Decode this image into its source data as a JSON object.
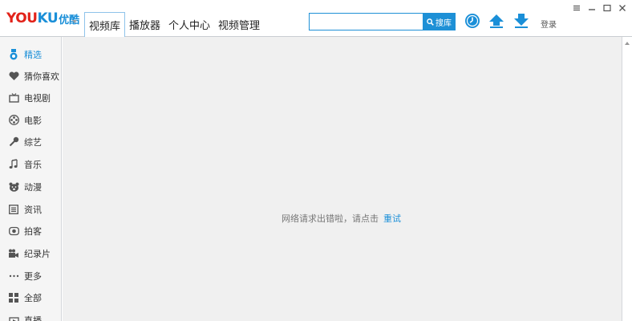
{
  "logo": {
    "en_you": "YOU",
    "en_ku": "KU",
    "cn": "优酷"
  },
  "tabs": [
    {
      "label": "视频库",
      "active": true
    },
    {
      "label": "播放器",
      "active": false
    },
    {
      "label": "个人中心",
      "active": false
    },
    {
      "label": "视频管理",
      "active": false
    }
  ],
  "search": {
    "value": "",
    "placeholder": "",
    "button_label": "搜库"
  },
  "toolbar": {
    "login_label": "登录"
  },
  "sidebar": {
    "items": [
      {
        "label": "精选",
        "icon": "medal-icon",
        "active": true
      },
      {
        "label": "猜你喜欢",
        "icon": "heart-icon",
        "active": false
      },
      {
        "label": "电视剧",
        "icon": "tv-icon",
        "active": false
      },
      {
        "label": "电影",
        "icon": "film-reel-icon",
        "active": false
      },
      {
        "label": "综艺",
        "icon": "microphone-icon",
        "active": false
      },
      {
        "label": "音乐",
        "icon": "music-note-icon",
        "active": false
      },
      {
        "label": "动漫",
        "icon": "bear-face-icon",
        "active": false
      },
      {
        "label": "资讯",
        "icon": "news-icon",
        "active": false
      },
      {
        "label": "拍客",
        "icon": "camera-icon",
        "active": false
      },
      {
        "label": "纪录片",
        "icon": "video-camera-icon",
        "active": false
      },
      {
        "label": "更多",
        "icon": "more-dots-icon",
        "active": false
      },
      {
        "label": "全部",
        "icon": "grid-icon",
        "active": false
      },
      {
        "label": "直播",
        "icon": "live-icon",
        "active": false
      }
    ]
  },
  "main": {
    "error_text": "网络请求出错啦，请点击",
    "retry_label": "重试"
  },
  "colors": {
    "accent": "#1a8fd8",
    "logo_red": "#e2231a",
    "main_bg": "#f0f0f0",
    "sidebar_bg": "#f5f5f5"
  }
}
